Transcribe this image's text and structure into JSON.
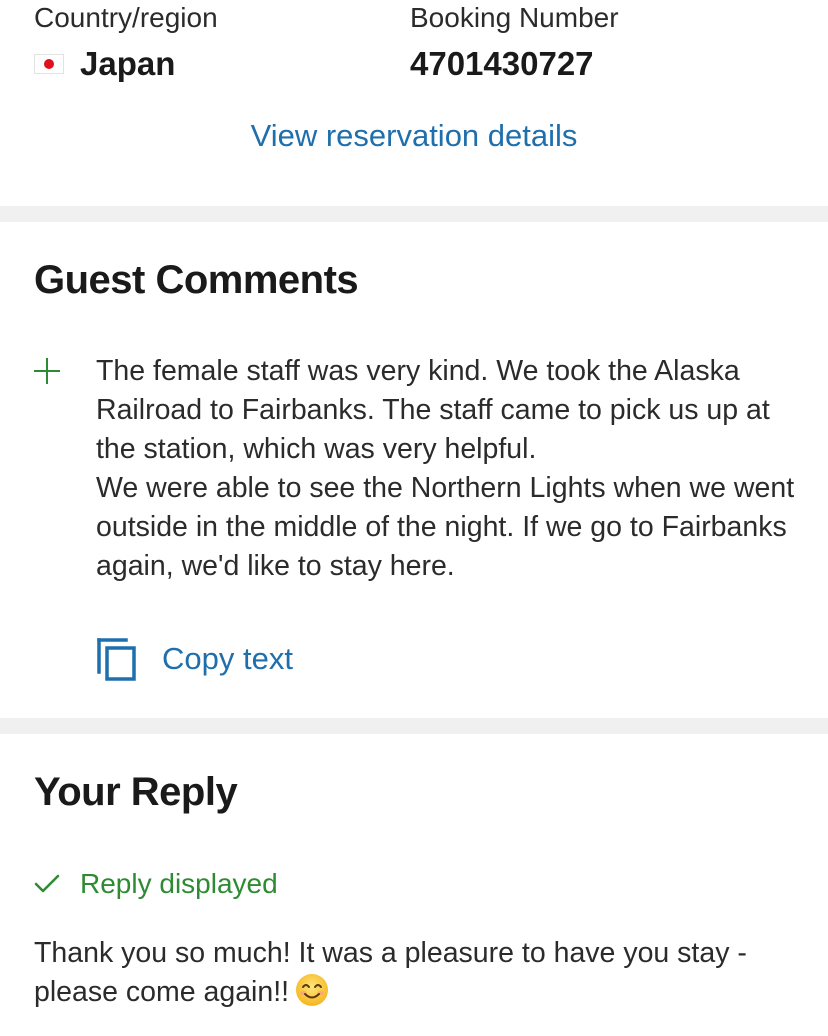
{
  "info": {
    "country_label": "Country/region",
    "country_value": "Japan",
    "booking_label": "Booking Number",
    "booking_value": "4701430727",
    "view_link": "View reservation details"
  },
  "comments": {
    "title": "Guest Comments",
    "text": "The female staff was very kind. We took the Alaska Railroad to Fairbanks. The staff came to pick us up at the station, which was very helpful.\nWe were able to see the Northern Lights when we went outside in the middle of the night. If we go to Fairbanks again, we'd like to stay here.",
    "copy_label": "Copy text"
  },
  "reply": {
    "title": "Your Reply",
    "status": "Reply displayed",
    "text": "Thank you so much! It was a pleasure to have you stay - please come again!!"
  },
  "colors": {
    "link": "#1f6fad",
    "positive": "#2e8b34",
    "divider": "#f0f0f0"
  },
  "icons": {
    "flag": "japan-flag-icon",
    "plus": "plus-icon",
    "copy": "copy-icon",
    "check": "check-icon",
    "emoji": "smiling-face-emoji-icon"
  }
}
